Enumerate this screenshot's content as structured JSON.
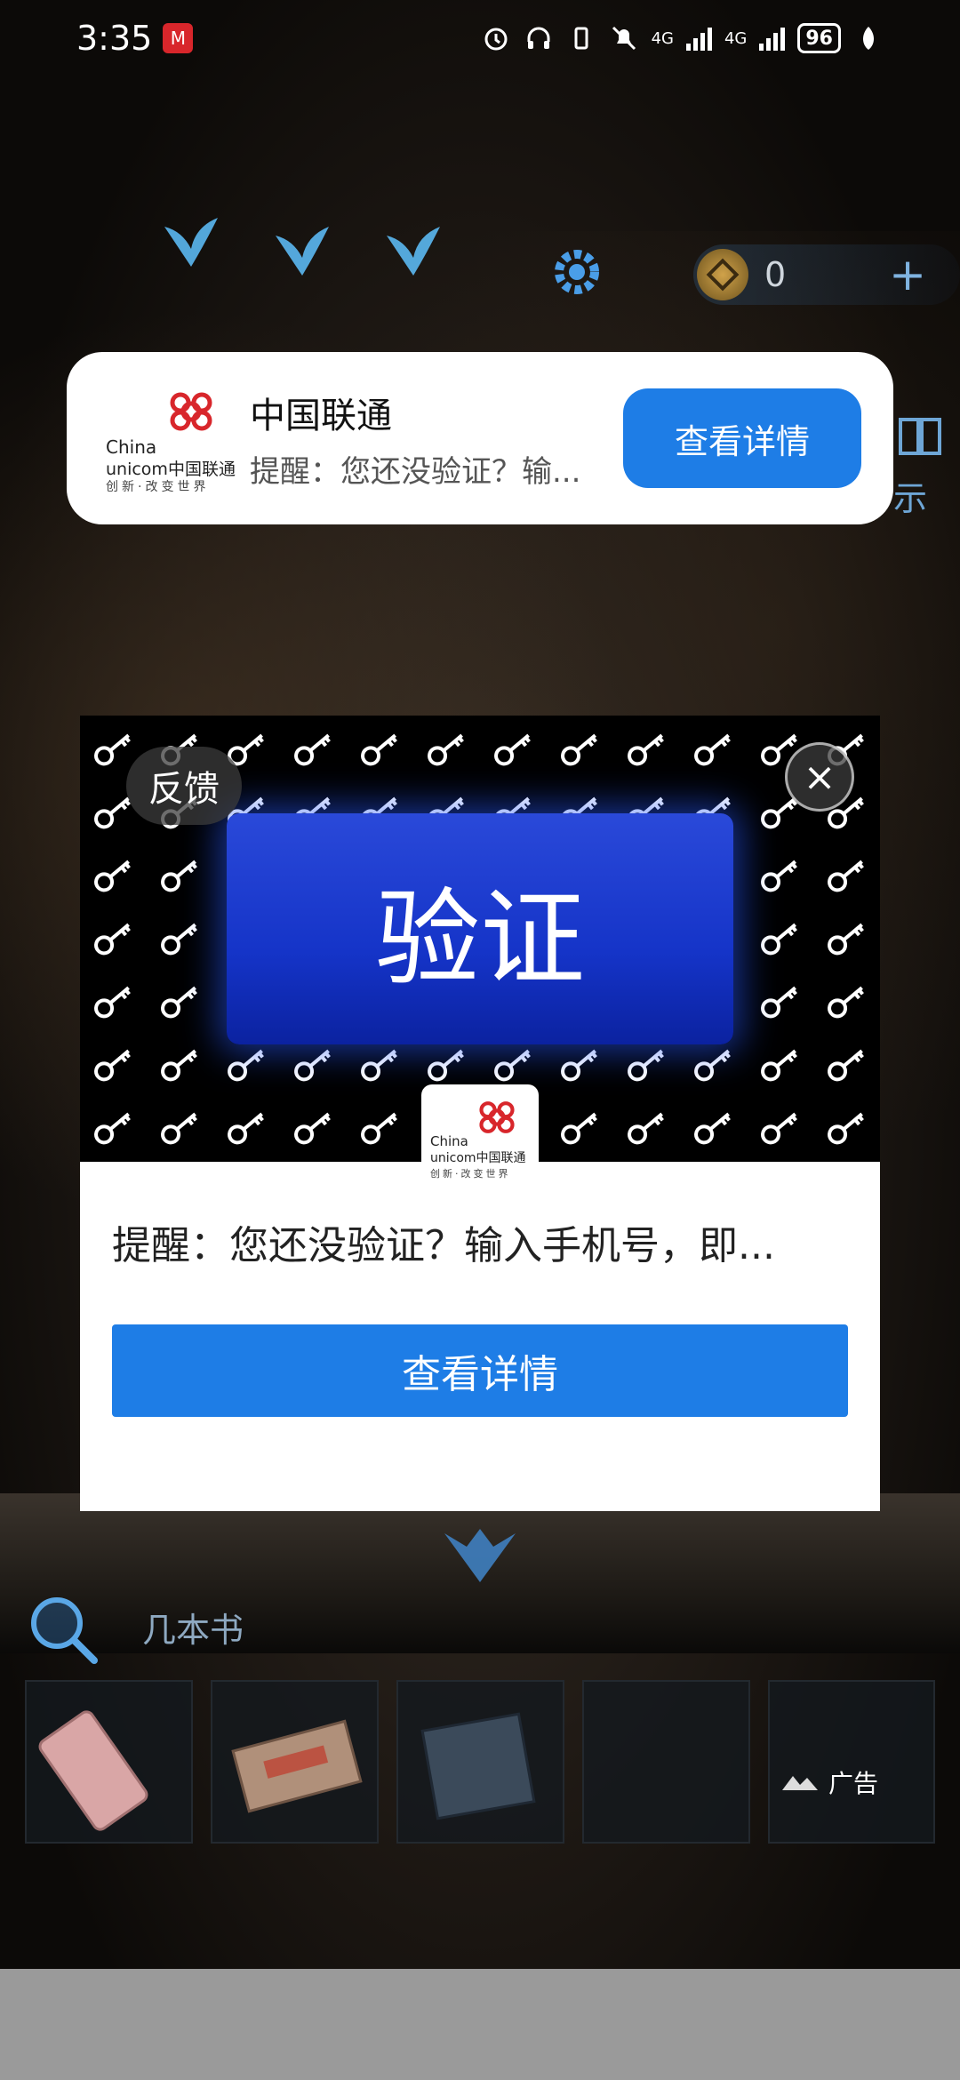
{
  "status_bar": {
    "time": "3:35",
    "carrier_badge": "M",
    "network_1": "4G",
    "network_2": "4G",
    "battery": "96"
  },
  "game": {
    "coin_count": "0",
    "plus_label": "+",
    "side_label": "示",
    "hint_label": "几本书"
  },
  "notification": {
    "title": "中国联通",
    "body": "提醒：您还没验证？输...",
    "button": "查看详情",
    "logo_en_1": "China",
    "logo_en_2": "unicom中国联通",
    "logo_slogan": "创新·改变世界"
  },
  "ad": {
    "banner_button": "验证",
    "feedback": "反馈",
    "close_symbol": "×",
    "logo_en_1": "China",
    "logo_en_2": "unicom中国联通",
    "logo_slogan": "创新·改变世界",
    "text": "提醒：您还没验证？输入手机号，即...",
    "button": "查看详情",
    "ad_tag": "广告"
  },
  "colors": {
    "accent_blue": "#1e7de6",
    "verify_blue": "#1534c8",
    "unicom_red": "#d8262b"
  }
}
